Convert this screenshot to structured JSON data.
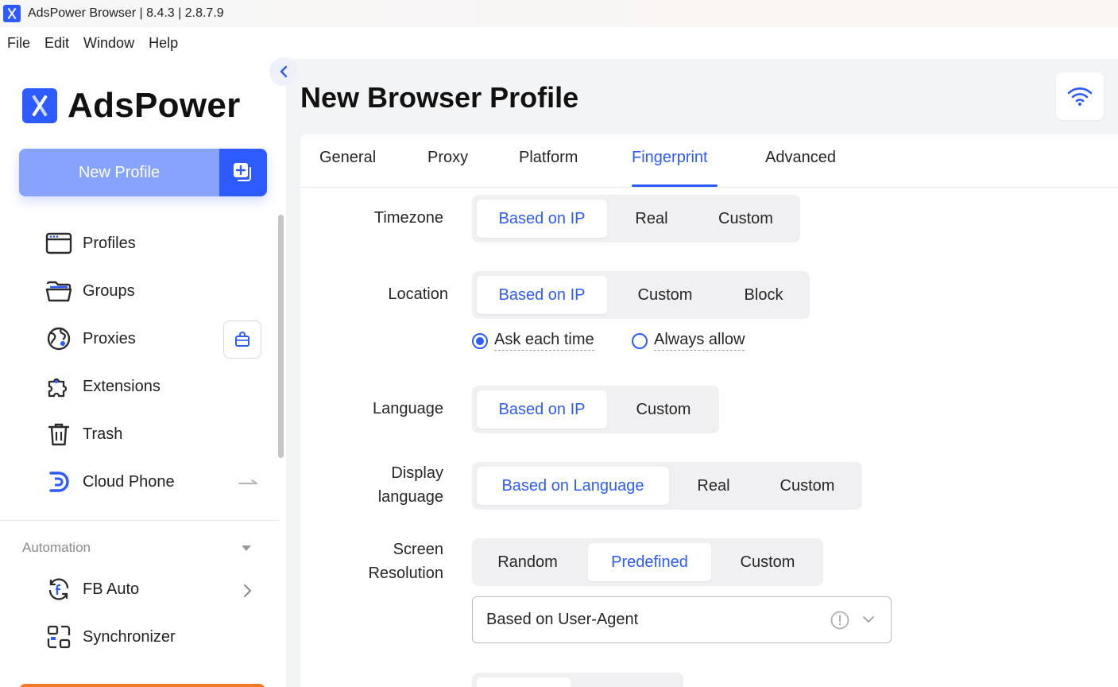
{
  "window": {
    "title": "AdsPower Browser | 8.4.3 | 2.8.7.9"
  },
  "menu": [
    "File",
    "Edit",
    "Window",
    "Help"
  ],
  "sidebar": {
    "logo_text": "AdsPower",
    "new_profile_label": "New Profile",
    "items": [
      {
        "label": "Profiles",
        "icon": "profiles-icon"
      },
      {
        "label": "Groups",
        "icon": "folder-icon"
      },
      {
        "label": "Proxies",
        "icon": "globe-icon"
      },
      {
        "label": "Extensions",
        "icon": "puzzle-icon"
      },
      {
        "label": "Trash",
        "icon": "trash-icon"
      },
      {
        "label": "Cloud Phone",
        "icon": "cloud-phone-icon"
      }
    ],
    "automation": {
      "title": "Automation",
      "items": [
        {
          "label": "FB Auto",
          "icon": "facebook-refresh-icon"
        },
        {
          "label": "Synchronizer",
          "icon": "synchronizer-icon"
        }
      ]
    }
  },
  "main": {
    "title": "New Browser Profile",
    "tabs": [
      "General",
      "Proxy",
      "Platform",
      "Fingerprint",
      "Advanced"
    ],
    "active_tab": "Fingerprint",
    "fingerprint": {
      "timezone": {
        "label": "Timezone",
        "options": [
          "Based on IP",
          "Real",
          "Custom"
        ],
        "selected": "Based on IP"
      },
      "location": {
        "label": "Location",
        "options": [
          "Based on IP",
          "Custom",
          "Block"
        ],
        "selected": "Based on IP",
        "permission": {
          "options": [
            "Ask each time",
            "Always allow"
          ],
          "selected": "Ask each time"
        }
      },
      "language": {
        "label": "Language",
        "options": [
          "Based on IP",
          "Custom"
        ],
        "selected": "Based on IP"
      },
      "display_language": {
        "label_line1": "Display",
        "label_line2": "language",
        "options": [
          "Based on Language",
          "Real",
          "Custom"
        ],
        "selected": "Based on Language"
      },
      "screen_resolution": {
        "label_line1": "Screen",
        "label_line2": "Resolution",
        "options": [
          "Random",
          "Predefined",
          "Custom"
        ],
        "selected": "Predefined",
        "dropdown_value": "Based on User-Agent"
      }
    }
  },
  "colors": {
    "accent": "#2d5bff",
    "accent_light": "#87a3fb",
    "main_bg": "#f3f4f6",
    "orange": "#f07a2a"
  }
}
